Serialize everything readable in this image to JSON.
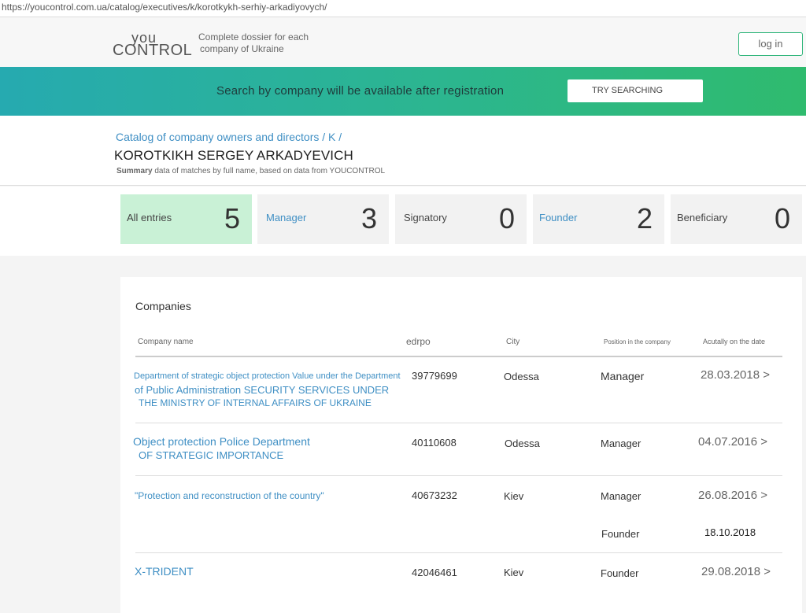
{
  "url": "https://youcontrol.com.ua/catalog/executives/k/korotkykh-serhiy-arkadiyovych/",
  "header": {
    "logo_top": "you",
    "logo_bottom": "CONTROL",
    "tagline_1": "Complete dossier for each",
    "tagline_2": "company of Ukraine",
    "login": "log in"
  },
  "banner": {
    "text": "Search by company will be available after registration",
    "button": "TRY SEARCHING"
  },
  "breadcrumb": [
    "Catalog of company owners and directors",
    "K"
  ],
  "breadcrumb_sep": "/",
  "person_name": "KOROTKIKH SERGEY ARKADYEVICH",
  "summary_bold": "Summary",
  "summary_rest": " data of matches by full name, based on data from YOUCONTROL",
  "stats": [
    {
      "label": "All entries",
      "count": "5"
    },
    {
      "label": "Manager",
      "count": "3"
    },
    {
      "label": "Signatory",
      "count": "0"
    },
    {
      "label": "Founder",
      "count": "2"
    },
    {
      "label": "Beneficiary",
      "count": "0"
    }
  ],
  "companies": {
    "title": "Companies",
    "columns": [
      "Company name",
      "edrpo",
      "City",
      "Position in the company",
      "Acutally on the date"
    ],
    "rows": [
      {
        "name_lines": [
          "Department of strategic object protection Value under the Department",
          "of Public Administration SECURITY SERVICES UNDER",
          "THE MINISTRY OF INTERNAL AFFAIRS OF UKRAINE"
        ],
        "edrpo": "39779699",
        "city": "Odessa",
        "position": "Manager",
        "date": "28.03.2018 >"
      },
      {
        "name_lines": [
          "Object protection Police Department",
          "OF STRATEGIC IMPORTANCE"
        ],
        "edrpo": "40110608",
        "city": "Odessa",
        "position": "Manager",
        "date": "04.07.2016 >"
      },
      {
        "name_lines": [
          "\"Protection and reconstruction of the country\""
        ],
        "edrpo": "40673232",
        "city": "Kiev",
        "position": "Manager",
        "date": "26.08.2016 >",
        "extra_position": "Founder",
        "extra_date": "18.10.2018"
      },
      {
        "name_lines": [
          "X-TRIDENT"
        ],
        "edrpo": "42046461",
        "city": "Kiev",
        "position": "Founder",
        "date": "29.08.2018 >"
      }
    ]
  },
  "colors": {
    "accent_blue": "#3f8fc4",
    "active_green": "#c9f1d6",
    "banner_start": "#26aab0",
    "banner_end": "#2fbb6e"
  }
}
